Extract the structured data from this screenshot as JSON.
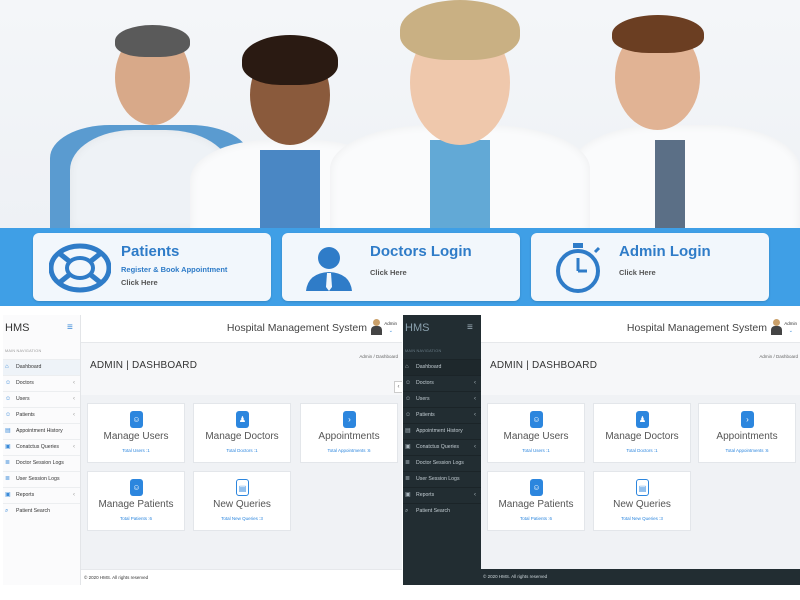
{
  "hero": {
    "cards": [
      {
        "title": "Patients",
        "subtitle": "Register & Book Appointment",
        "link": "Click Here",
        "icon": "lifebuoy-icon"
      },
      {
        "title": "Doctors Login",
        "subtitle": "",
        "link": "Click Here",
        "icon": "doctor-icon"
      },
      {
        "title": "Admin Login",
        "subtitle": "",
        "link": "Click Here",
        "icon": "stopwatch-icon"
      }
    ]
  },
  "app": {
    "brand": "HMS",
    "system_title": "Hospital Management System",
    "admin_name": "Admin",
    "nav_header": "MAIN NAVIGATION",
    "nav": [
      {
        "label": "Dashboard",
        "icon": "home-icon",
        "chevron": false
      },
      {
        "label": "Doctors",
        "icon": "user-icon",
        "chevron": true
      },
      {
        "label": "Users",
        "icon": "user-icon",
        "chevron": true
      },
      {
        "label": "Patients",
        "icon": "user-icon",
        "chevron": true
      },
      {
        "label": "Appointment History",
        "icon": "file-icon",
        "chevron": false
      },
      {
        "label": "Conatctus Queries",
        "icon": "files-icon",
        "chevron": true
      },
      {
        "label": "Doctor Session Logs",
        "icon": "list-icon",
        "chevron": false
      },
      {
        "label": "User Session Logs",
        "icon": "list-icon",
        "chevron": false
      },
      {
        "label": "Reports",
        "icon": "files-icon",
        "chevron": true
      },
      {
        "label": "Patient Search",
        "icon": "search-icon",
        "chevron": false
      }
    ],
    "page_title": "ADMIN | DASHBOARD",
    "breadcrumb_home": "Admin",
    "breadcrumb_sep": "/",
    "breadcrumb_current": "Dashboard",
    "tiles": [
      {
        "title": "Manage Users",
        "stat": "Total Users :1",
        "icon": "smile-icon"
      },
      {
        "title": "Manage Doctors",
        "stat": "Total Doctors :1",
        "icon": "doctor-icon"
      },
      {
        "title": "Appointments",
        "stat": "Total Appointments :6",
        "icon": "terminal-icon"
      },
      {
        "title": "Manage Patients",
        "stat": "Total Patients :6",
        "icon": "smile-icon"
      },
      {
        "title": "New Queries",
        "stat": "Total New Queries :3",
        "icon": "files-icon"
      }
    ],
    "footer": "© 2020 HMS. All rights reserved",
    "footer_dark": "© 2020 HMS. All rights reserved",
    "colors": {
      "blue": "#3f9fe6",
      "accent": "#2c86de",
      "dark_sidebar": "#222d32"
    }
  }
}
